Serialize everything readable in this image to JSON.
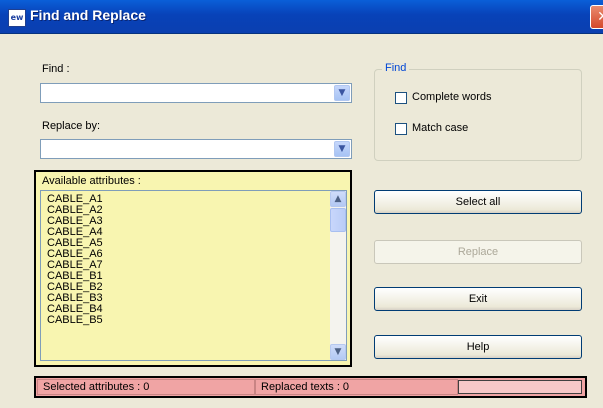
{
  "window": {
    "title": "Find and Replace",
    "app_icon": "ew",
    "close_label": "✕"
  },
  "find": {
    "label": "Find :",
    "value": ""
  },
  "replace": {
    "label": "Replace by:",
    "value": ""
  },
  "find_options": {
    "group_title": "Find",
    "complete_words_label": "Complete words",
    "complete_words_checked": false,
    "match_case_label": "Match case",
    "match_case_checked": false
  },
  "attributes": {
    "title": "Available attributes :",
    "items": [
      "CABLE_A1",
      "CABLE_A2",
      "CABLE_A3",
      "CABLE_A4",
      "CABLE_A5",
      "CABLE_A6",
      "CABLE_A7",
      "CABLE_B1",
      "CABLE_B2",
      "CABLE_B3",
      "CABLE_B4",
      "CABLE_B5"
    ]
  },
  "buttons": {
    "select_all": "Select all",
    "replace": "Replace",
    "exit": "Exit",
    "help": "Help"
  },
  "status": {
    "selected": "Selected attributes : 0",
    "replaced": "Replaced texts : 0",
    "progress": 0
  },
  "colors": {
    "titlebar": "#0842b8",
    "attributes_bg": "#f8f5b0",
    "status_bg": "#f0a4a4",
    "group_title": "#0046d5"
  }
}
